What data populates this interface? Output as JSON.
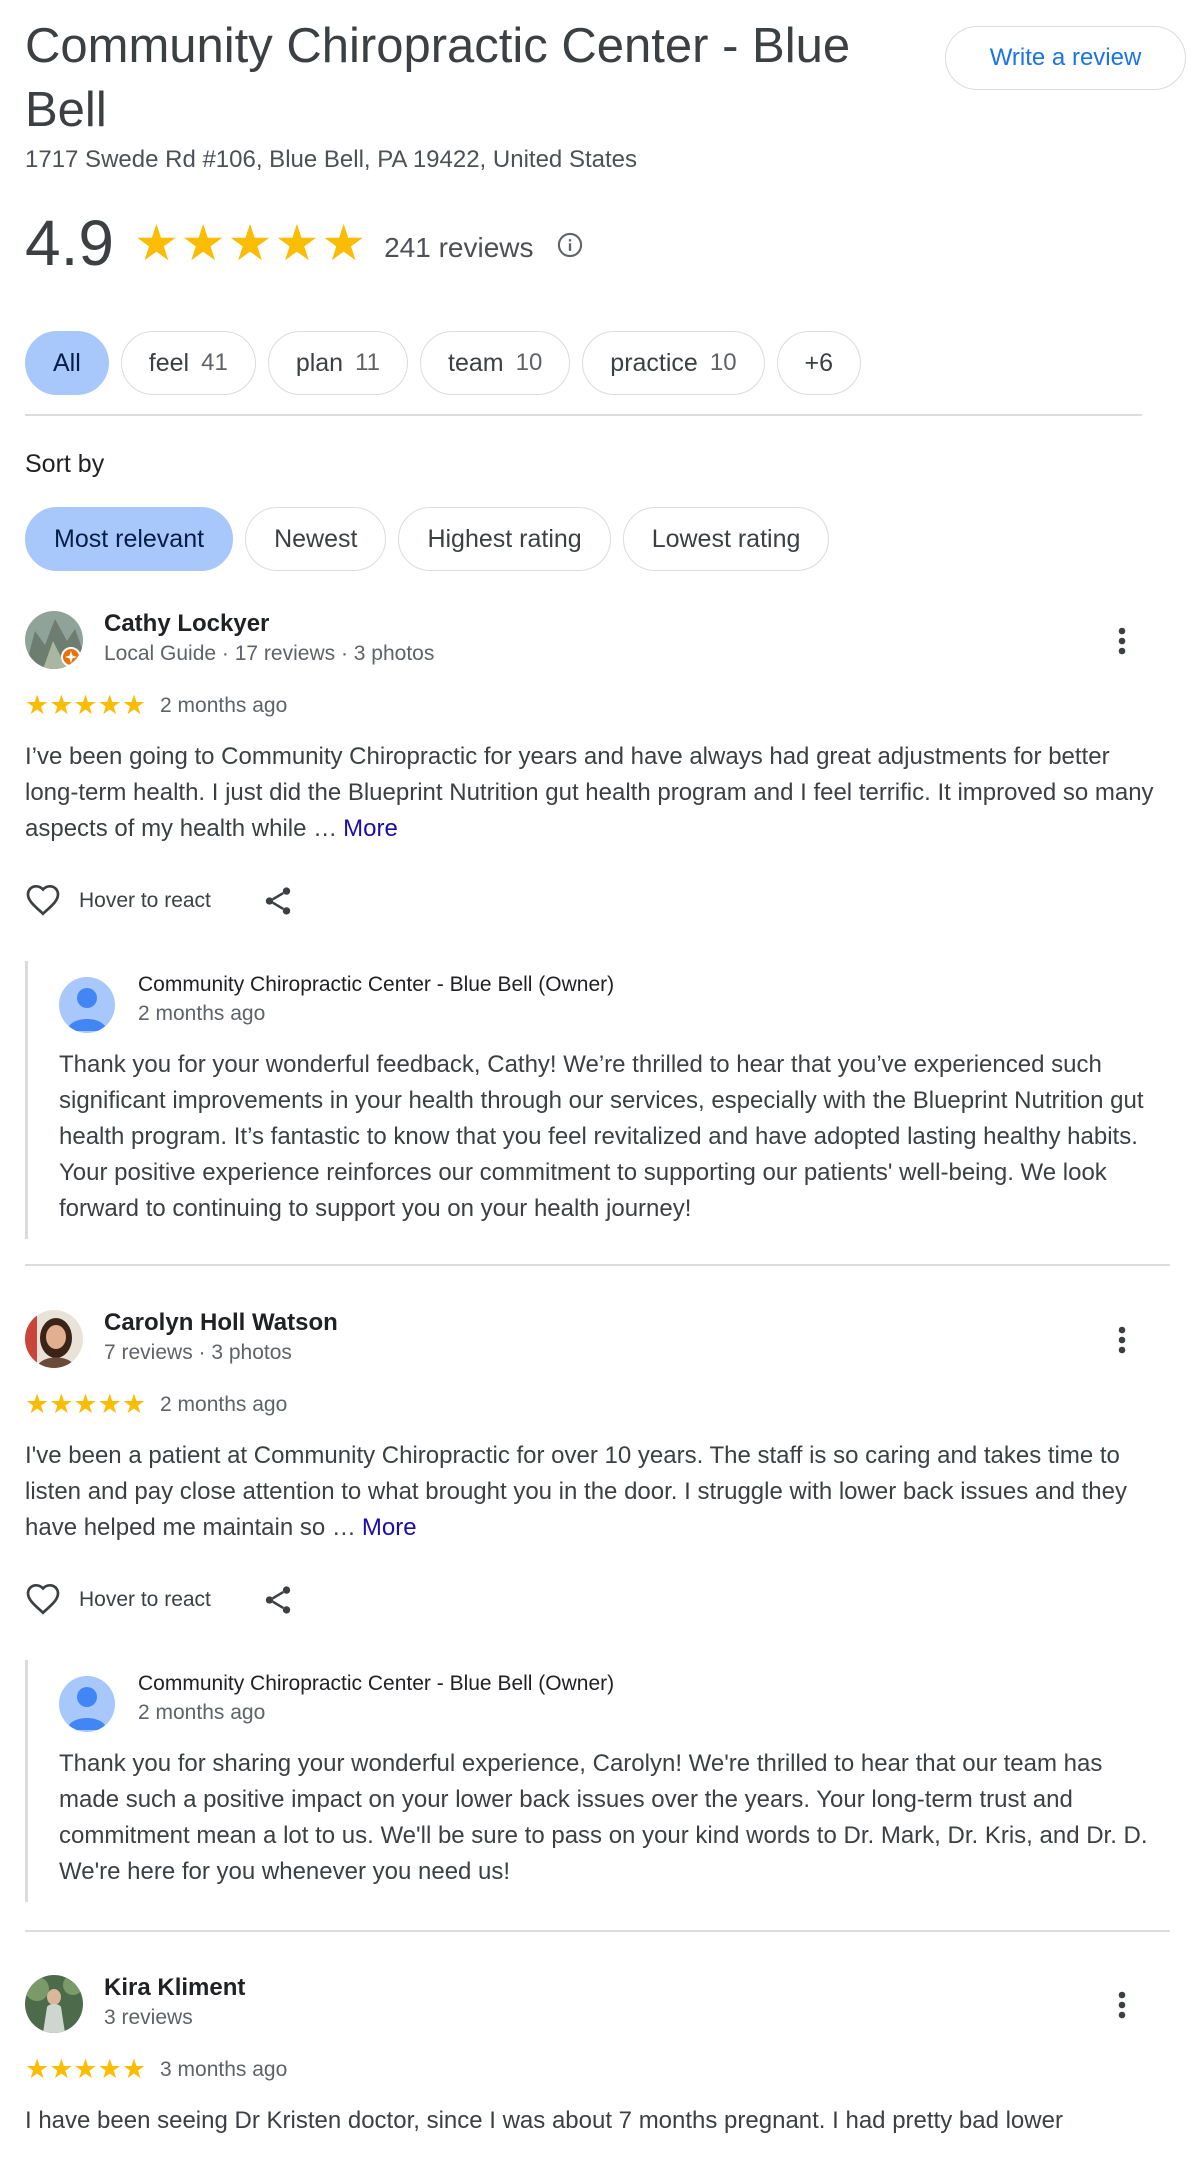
{
  "business": {
    "title": "Community Chiropractic Center - Blue Bell",
    "address": "1717 Swede Rd #106, Blue Bell, PA 19422, United States",
    "write_review_label": "Write a review"
  },
  "rating": {
    "value": "4.9",
    "stars_out_of_5": 4.9,
    "review_count_label": "241 reviews",
    "info_icon": "info-icon"
  },
  "topic_chips": [
    {
      "label": "All",
      "count": "",
      "active": true
    },
    {
      "label": "feel",
      "count": "41",
      "active": false
    },
    {
      "label": "plan",
      "count": "11",
      "active": false
    },
    {
      "label": "team",
      "count": "10",
      "active": false
    },
    {
      "label": "practice",
      "count": "10",
      "active": false
    },
    {
      "label": "+6",
      "count": "",
      "active": false
    }
  ],
  "sort": {
    "label": "Sort by",
    "options": [
      {
        "label": "Most relevant",
        "active": true
      },
      {
        "label": "Newest",
        "active": false
      },
      {
        "label": "Highest rating",
        "active": false
      },
      {
        "label": "Lowest rating",
        "active": false
      }
    ]
  },
  "reviews": [
    {
      "name": "Cathy Lockyer",
      "meta": "Local Guide · 17 reviews · 3 photos",
      "stars": 5,
      "time": "2 months ago",
      "text": "I’ve been going to Community Chiropractic for years and have always had great adjustments for better long-term health. I just did the Blueprint Nutrition gut health program and I feel terrific. It improved so many aspects of my health while …",
      "more_label": "More",
      "react_label": "Hover to react",
      "owner": {
        "name": "Community Chiropractic Center - Blue Bell (Owner)",
        "time": "2 months ago",
        "text": "Thank you for your wonderful feedback, Cathy! We’re thrilled to hear that you’ve experienced such significant improvements in your health through our services, especially with the Blueprint Nutrition gut health program. It’s fantastic to know that you feel revitalized and have adopted lasting healthy habits. Your positive experience reinforces our commitment to supporting our patients' well-being. We look forward to continuing to support you on your health journey!"
      }
    },
    {
      "name": "Carolyn Holl Watson",
      "meta": "7 reviews · 3 photos",
      "stars": 5,
      "time": "2 months ago",
      "text": "I've been a patient at Community Chiropractic for over 10 years. The staff is so caring and takes time to listen and pay close attention to what brought you in the door. I struggle with lower back issues and they have helped me maintain so …",
      "more_label": "More",
      "react_label": "Hover to react",
      "owner": {
        "name": "Community Chiropractic Center - Blue Bell (Owner)",
        "time": "2 months ago",
        "text": "Thank you for sharing your wonderful experience, Carolyn! We're thrilled to hear that our team has made such a positive impact on your lower back issues over the years. Your long-term trust and commitment mean a lot to us. We'll be sure to pass on your kind words to Dr. Mark, Dr. Kris, and Dr. D. We're here for you whenever you need us!"
      }
    },
    {
      "name": "Kira Kliment",
      "meta": "3 reviews",
      "stars": 5,
      "time": "3 months ago",
      "text": "I have been seeing Dr Kristen doctor, since I was about 7 months pregnant. I had pretty bad lower"
    }
  ],
  "colors": {
    "star": "#fbbc04",
    "active_chip": "#a8c7fa",
    "link": "#1a0dab",
    "accent": "#1a73e8"
  }
}
